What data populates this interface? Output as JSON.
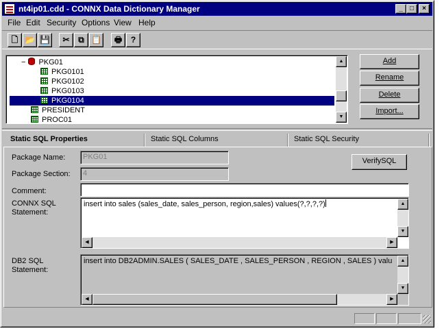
{
  "window": {
    "title": "nt4ip01.cdd - CONNX Data Dictionary Manager",
    "minimize_glyph": "_",
    "maximize_glyph": "□",
    "close_glyph": "×"
  },
  "menu": [
    {
      "label": "File"
    },
    {
      "label": "Edit"
    },
    {
      "label": "Security"
    },
    {
      "label": "Options"
    },
    {
      "label": "View"
    },
    {
      "label": "Help"
    }
  ],
  "toolbar": {
    "icons": [
      "new-file-icon",
      "open-folder-icon",
      "save-disk-icon",
      "cut-scissors-icon",
      "copy-icon",
      "paste-clipboard-icon",
      "print-icon",
      "help-question-icon"
    ],
    "glyphs": [
      "🗋",
      "📂",
      "💾",
      "✂",
      "⧉",
      "📋",
      "🖶",
      "?"
    ]
  },
  "tree": {
    "items": [
      {
        "label": "PKG01",
        "expander": "−",
        "icon": "database-icon"
      },
      {
        "label": "PKG0101",
        "icon": "table-grid-icon"
      },
      {
        "label": "PKG0102",
        "icon": "table-grid-icon"
      },
      {
        "label": "PKG0103",
        "icon": "table-grid-icon"
      },
      {
        "label": "PKG0104",
        "icon": "table-grid-icon",
        "selected": true
      },
      {
        "label": "PRESIDENT",
        "icon": "table-grid-icon"
      },
      {
        "label": "PROC01",
        "icon": "table-grid-icon"
      }
    ]
  },
  "side_buttons": {
    "add": "Add",
    "rename": "Rename",
    "delete": "Delete",
    "import": "Import..."
  },
  "tabs": [
    {
      "label": "Static SQL Properties",
      "active": true
    },
    {
      "label": "Static SQL Columns"
    },
    {
      "label": "Static SQL Security"
    }
  ],
  "form": {
    "package_name_label": "Package Name:",
    "package_name_value": "PKG01",
    "package_section_label": "Package Section:",
    "package_section_value": "4",
    "verify_button": "VerifySQL",
    "comment_label": "Comment:",
    "comment_value": "",
    "connx_sql_label_1": "CONNX SQL",
    "connx_sql_label_2": "Statement:",
    "connx_sql_value": "insert into sales (sales_date, sales_person, region,sales) values(?,?,?,?)",
    "db2_sql_label_1": "DB2 SQL",
    "db2_sql_label_2": "Statement:",
    "db2_sql_value": "insert  into  DB2ADMIN.SALES (  SALES_DATE  ,  SALES_PERSON  ,  REGION  ,  SALES )  valu"
  },
  "colors": {
    "titlebar": "#000080",
    "selection": "#000080",
    "face": "#c0c0c0"
  }
}
